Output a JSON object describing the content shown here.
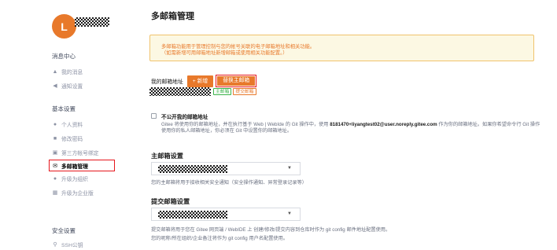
{
  "profile": {
    "avatar_letter": "L"
  },
  "sidebar": {
    "sections": [
      {
        "title": "消息中心",
        "items": [
          {
            "label": "我的消息",
            "icon": "bell-icon"
          },
          {
            "label": "通知设置",
            "icon": "speaker-icon"
          }
        ]
      },
      {
        "title": "基本设置",
        "items": [
          {
            "label": "个人资料",
            "icon": "person-icon"
          },
          {
            "label": "修改密码",
            "icon": "lock-icon"
          },
          {
            "label": "第三方帐号绑定",
            "icon": "link-icon"
          },
          {
            "label": "多邮箱管理",
            "icon": "envelope-icon",
            "active": true
          },
          {
            "label": "升级为组织",
            "icon": "group-icon"
          },
          {
            "label": "升级为企业版",
            "icon": "building-icon"
          }
        ]
      },
      {
        "title": "安全设置",
        "items": [
          {
            "label": "SSH公钥",
            "icon": "key-icon"
          }
        ]
      }
    ]
  },
  "main": {
    "title": "多邮箱管理",
    "notice_line1": "多邮箱功能用于管理控制与您的帐号关联的电子邮箱地址和相关功能。",
    "notice_line2": "（如需新增可用邮箱地址新增邮箱或使用相关功能配置。）",
    "my_email_label": "我的邮箱地址",
    "new_button": "+ 新增",
    "replace_button": "替换主邮箱",
    "tags": {
      "primary": "主邮箱",
      "commit": "提交邮箱"
    },
    "private": {
      "title": "不公开我的邮箱地址",
      "desc_prefix": "Gitee 将使用你的邮箱地址，并在执行基于 Web | WebIde 的 Git 操作中，使用 ",
      "desc_email": "8181470+liyangtest02@user.noreply.gitee.com",
      "desc_suffix": " 作为你的邮箱地址。如果你希望命令行 Git 操作使用你的私人邮箱地址，你必须在 Git 中设置你的邮箱地址。"
    },
    "primary_section": {
      "title": "主邮箱设置",
      "desc": "您的主邮箱将用于接收相关安全通知（安全操作通知、异常登录记录等）"
    },
    "commit_section": {
      "title": "提交邮箱设置",
      "desc1": "提交邮箱将用于您在 Gitee 网页端 / WebIDE 上 创建/修改/提交内容到仓库时作为 git config 邮件地址配置使用。",
      "desc2": "您的昵称/所在组织/企业备注将作为 git config 用户名配置使用。"
    }
  },
  "colors": {
    "accent": "#e8792b",
    "highlight_border": "#e6161c",
    "tag_green": "#3bb34a",
    "notice_bg": "#fcf8e3"
  }
}
